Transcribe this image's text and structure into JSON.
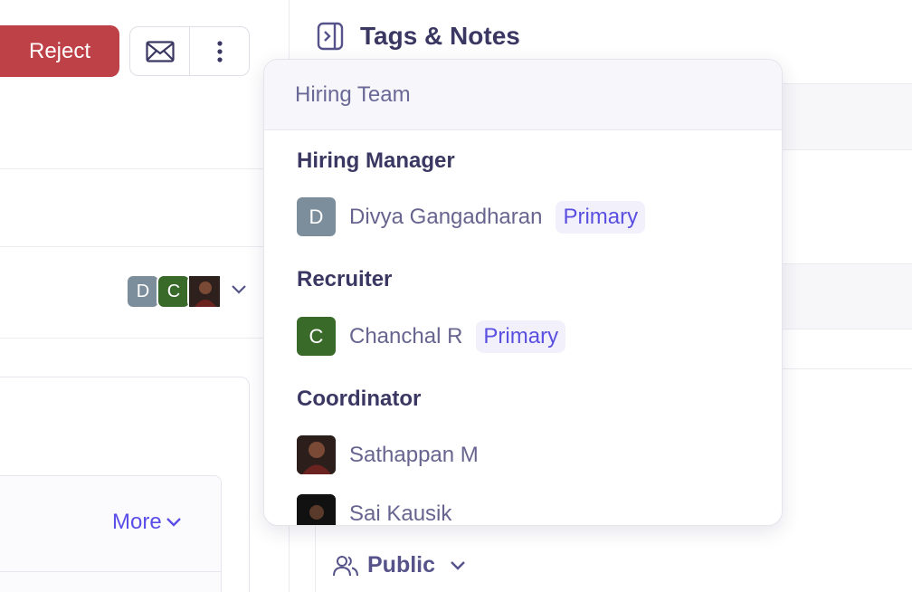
{
  "toolbar": {
    "reject_label": "Reject",
    "icons": {
      "mail": "envelope-icon",
      "more": "vertical-ellipsis-icon"
    }
  },
  "stage_row": {
    "avatars": [
      {
        "initial": "D",
        "color": "#7c8e9b"
      },
      {
        "initial": "C",
        "color": "#3a6a2a"
      }
    ]
  },
  "card": {
    "more_label": "More"
  },
  "panel": {
    "title": "Tags & Notes",
    "visibility_label": "Public"
  },
  "hiring_team": {
    "header": "Hiring Team",
    "sections": [
      {
        "label": "Hiring Manager",
        "members": [
          {
            "initial": "D",
            "name": "Divya Gangadharan",
            "badge": "Primary",
            "avatar_color": "#7c8e9b"
          }
        ]
      },
      {
        "label": "Recruiter",
        "members": [
          {
            "initial": "C",
            "name": "Chanchal R",
            "badge": "Primary",
            "avatar_color": "#3a6a2a"
          }
        ]
      },
      {
        "label": "Coordinator",
        "members": [
          {
            "name": "Sathappan M"
          },
          {
            "name": "Sai Kausik"
          }
        ]
      }
    ]
  },
  "colors": {
    "accent": "#5b4ee8",
    "danger": "#bd4146",
    "heading": "#3a3762"
  }
}
